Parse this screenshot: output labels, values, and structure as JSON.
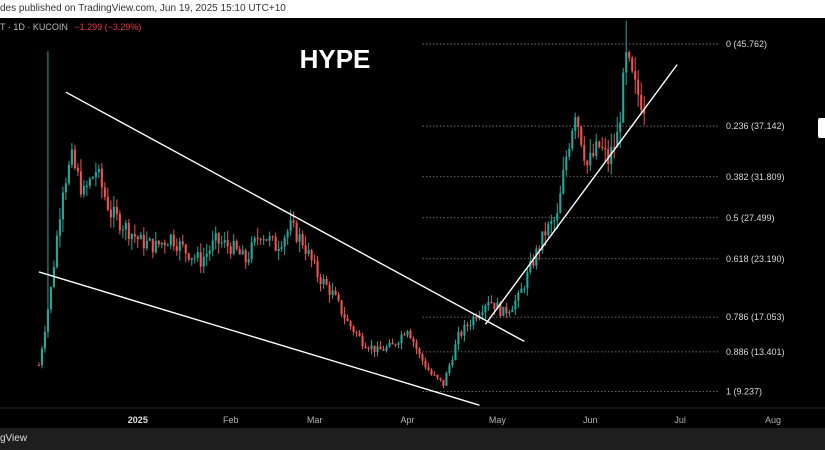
{
  "header": {
    "published_text": "des published on TradingView.com, Jun 19, 2025 15:10 UTC+10",
    "symbol_text": "T · 1D · KUCOIN",
    "change_text": "−1.299 (−3.29%)"
  },
  "footer": {
    "brand_text": "gView"
  },
  "colors": {
    "up": "#26a69a",
    "down": "#ef5350",
    "fib": "#8a8a8a",
    "trend": "#ffffff"
  },
  "chart_data": {
    "type": "candlestick",
    "title": "HYPE",
    "y_range": [
      7.5,
      48.5
    ],
    "x_range": [
      "2024-11-16",
      "2025-08-10"
    ],
    "x_ticks": [
      {
        "date": "2025-01-01",
        "label": "2025",
        "bold": true
      },
      {
        "date": "2025-02-01",
        "label": "Feb"
      },
      {
        "date": "2025-03-01",
        "label": "Mar"
      },
      {
        "date": "2025-04-01",
        "label": "Apr"
      },
      {
        "date": "2025-05-01",
        "label": "May"
      },
      {
        "date": "2025-06-01",
        "label": "Jun"
      },
      {
        "date": "2025-07-01",
        "label": "Jul"
      },
      {
        "date": "2025-08-01",
        "label": "Aug"
      }
    ],
    "fib_levels": [
      {
        "label": "0 (45.762)",
        "value": 45.762
      },
      {
        "label": "0.236 (37.142)",
        "value": 37.142
      },
      {
        "label": "0.382 (31.809)",
        "value": 31.809
      },
      {
        "label": "0.5 (27.499)",
        "value": 27.499
      },
      {
        "label": "0.618 (23.190)",
        "value": 23.19
      },
      {
        "label": "0.786 (17.053)",
        "value": 17.053
      },
      {
        "label": "0.886 (13.401)",
        "value": 13.401
      },
      {
        "label": "1 (9.237)",
        "value": 9.237
      }
    ],
    "trendlines": [
      {
        "name": "wedge-upper",
        "from": [
          "2024-12-08",
          40.7
        ],
        "to": [
          "2025-05-10",
          14.5
        ]
      },
      {
        "name": "wedge-lower",
        "from": [
          "2024-11-29",
          21.8
        ],
        "to": [
          "2025-04-25",
          7.8
        ]
      },
      {
        "name": "rising-support",
        "from": [
          "2025-04-27",
          16.3
        ],
        "to": [
          "2025-06-30",
          43.6
        ]
      }
    ],
    "anchors": [
      [
        "2024-11-29",
        12.0
      ],
      [
        "2024-12-03",
        20.0
      ],
      [
        "2024-12-07",
        31.0
      ],
      [
        "2024-12-10",
        33.5
      ],
      [
        "2024-12-14",
        30.0
      ],
      [
        "2024-12-18",
        32.5
      ],
      [
        "2024-12-23",
        28.0
      ],
      [
        "2024-12-28",
        26.5
      ],
      [
        "2025-01-02",
        25.0
      ],
      [
        "2025-01-07",
        24.5
      ],
      [
        "2025-01-12",
        25.5
      ],
      [
        "2025-01-17",
        24.0
      ],
      [
        "2025-01-22",
        23.0
      ],
      [
        "2025-01-27",
        25.0
      ],
      [
        "2025-02-01",
        24.5
      ],
      [
        "2025-02-06",
        23.0
      ],
      [
        "2025-02-11",
        26.0
      ],
      [
        "2025-02-16",
        24.5
      ],
      [
        "2025-02-21",
        26.5
      ],
      [
        "2025-02-25",
        25.0
      ],
      [
        "2025-03-02",
        21.5
      ],
      [
        "2025-03-07",
        19.5
      ],
      [
        "2025-03-12",
        16.5
      ],
      [
        "2025-03-17",
        14.5
      ],
      [
        "2025-03-22",
        13.5
      ],
      [
        "2025-03-27",
        14.0
      ],
      [
        "2025-04-01",
        16.0
      ],
      [
        "2025-04-05",
        13.0
      ],
      [
        "2025-04-09",
        11.0
      ],
      [
        "2025-04-13",
        10.0
      ],
      [
        "2025-04-18",
        15.0
      ],
      [
        "2025-04-23",
        17.0
      ],
      [
        "2025-04-28",
        19.0
      ],
      [
        "2025-05-03",
        17.5
      ],
      [
        "2025-05-08",
        19.0
      ],
      [
        "2025-05-13",
        23.0
      ],
      [
        "2025-05-17",
        26.0
      ],
      [
        "2025-05-21",
        27.5
      ],
      [
        "2025-05-24",
        34.0
      ],
      [
        "2025-05-27",
        39.0
      ],
      [
        "2025-05-31",
        33.0
      ],
      [
        "2025-06-04",
        35.0
      ],
      [
        "2025-06-07",
        33.5
      ],
      [
        "2025-06-10",
        36.0
      ],
      [
        "2025-06-13",
        44.0
      ],
      [
        "2025-06-16",
        41.0
      ],
      [
        "2025-06-19",
        39.5
      ]
    ],
    "candle_seed": 7
  }
}
